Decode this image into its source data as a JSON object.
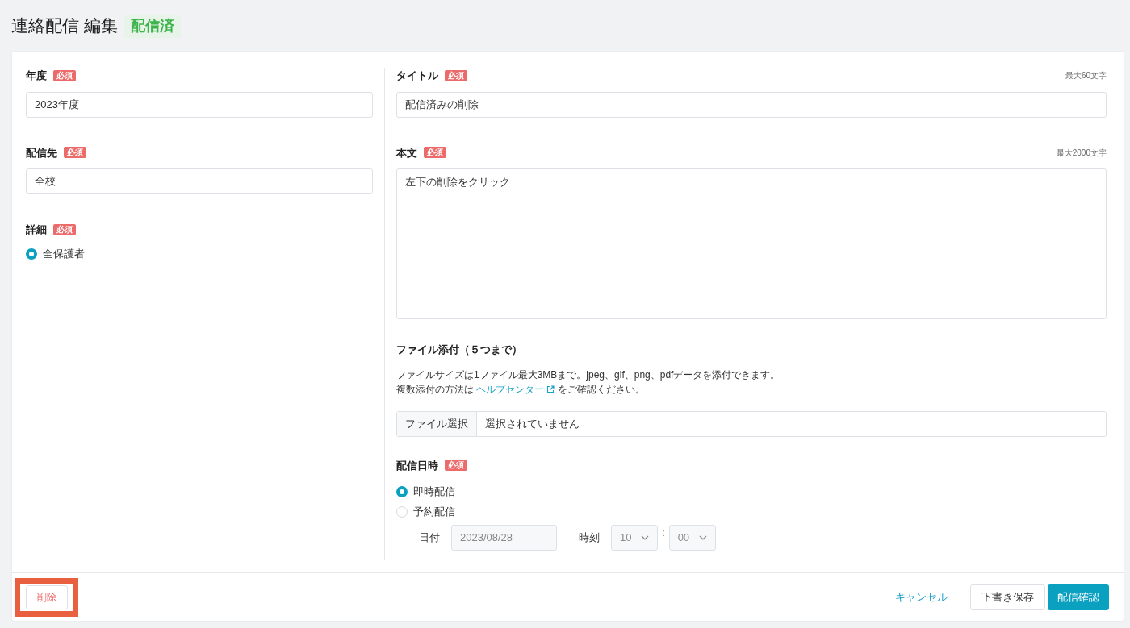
{
  "page": {
    "title": "連絡配信 編集",
    "status": "配信済"
  },
  "left_fields": [
    {
      "kind": "input",
      "label": "年度",
      "badge": "必須",
      "value": "2023年度"
    },
    {
      "kind": "input",
      "label": "配信先",
      "badge": "必須",
      "value": "全校"
    },
    {
      "kind": "radio",
      "label": "詳細",
      "badge": "必須",
      "options": [
        {
          "label": "全保護者",
          "selected": true
        }
      ]
    }
  ],
  "title_field": {
    "label": "タイトル",
    "badge": "必須",
    "limit": "最大60文字",
    "value": "配信済みの削除"
  },
  "body_field": {
    "label": "本文",
    "badge": "必須",
    "limit": "最大2000文字",
    "value": "左下の削除をクリック"
  },
  "attachment": {
    "heading": "ファイル添付（５つまで）",
    "note": "ファイルサイズは1ファイル最大3MBまで。jpeg、gif、png、pdfデータを添付できます。",
    "help_prefix": "複数添付の方法は",
    "help_link": "ヘルプセンター",
    "help_suffix": "をご確認ください。",
    "picker_button": "ファイル選択",
    "picker_status": "選択されていません"
  },
  "schedule": {
    "label": "配信日時",
    "badge": "必須",
    "options": [
      {
        "label": "即時配信",
        "selected": true
      },
      {
        "label": "予約配信",
        "selected": false
      }
    ],
    "date_label": "日付",
    "date_value": "2023/08/28",
    "time_label": "時刻",
    "hour": "10",
    "separator": ":",
    "minute": "00",
    "disabled": true
  },
  "footer": {
    "delete": {
      "label": "削除",
      "highlighted": true
    },
    "cancel": "キャンセル",
    "draft": "下書き保存",
    "confirm": "配信確認"
  }
}
